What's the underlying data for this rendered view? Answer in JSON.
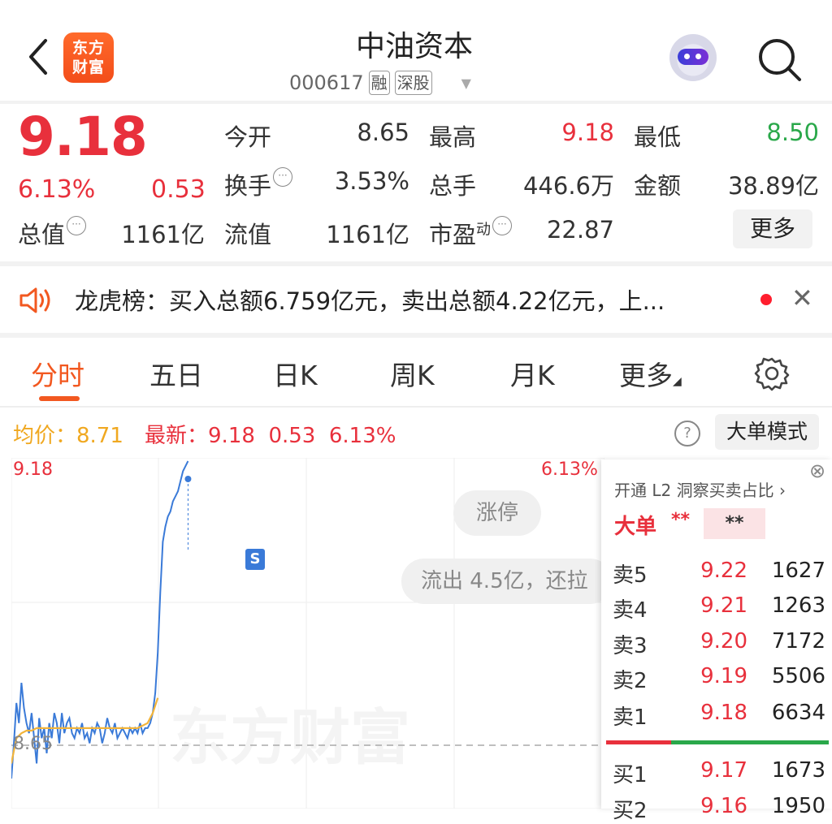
{
  "header": {
    "title": "中油资本",
    "code": "000617",
    "tags": [
      "融",
      "深股"
    ],
    "logo_text_top": "东方",
    "logo_text_bottom": "财富"
  },
  "quote": {
    "price": "9.18",
    "change_pct": "6.13%",
    "change": "0.53",
    "fields": [
      {
        "label": "今开",
        "value": "8.65",
        "tone": "neutral"
      },
      {
        "label": "最高",
        "value": "9.18",
        "tone": "up"
      },
      {
        "label": "最低",
        "value": "8.50",
        "tone": "down"
      },
      {
        "label": "换手",
        "value": "3.53%",
        "tone": "neutral"
      },
      {
        "label": "总手",
        "value": "446.6万",
        "tone": "neutral"
      },
      {
        "label": "金额",
        "value": "38.89亿",
        "tone": "neutral"
      },
      {
        "label": "总值",
        "value": "1161亿",
        "tone": "neutral"
      },
      {
        "label": "流值",
        "value": "1161亿",
        "tone": "neutral"
      },
      {
        "label": "市盈",
        "label_sup": "动",
        "value": "22.87",
        "tone": "neutral"
      }
    ],
    "more_label": "更多"
  },
  "notice": {
    "text": "龙虎榜：买入总额6.759亿元，卖出总额4.22亿元，上..."
  },
  "tabs": [
    "分时",
    "五日",
    "日K",
    "周K",
    "月K",
    "更多"
  ],
  "active_tab": 0,
  "indicators": {
    "avg_label": "均价：8.71",
    "latest_label": "最新：",
    "latest_price": "9.18",
    "latest_change": "0.53",
    "latest_pct": "6.13%",
    "big_order_mode": "大单模式"
  },
  "chart_data": {
    "type": "line",
    "axis_top_label": "9.18",
    "axis_top_pct": "6.13%",
    "axis_mid_label": "8.65",
    "ylim": [
      8.5,
      9.18
    ],
    "watermark": "东方财富",
    "series": [
      {
        "name": "",
        "role": "price",
        "color": "#3a7ad8",
        "x": [
          0,
          2,
          4,
          6,
          8,
          10,
          12,
          14,
          16,
          18,
          20,
          22,
          24,
          26,
          28,
          30,
          32,
          34,
          36,
          38,
          40,
          42,
          44,
          46,
          48,
          50,
          52,
          54,
          56,
          58,
          60,
          62,
          64,
          66,
          68,
          70,
          72,
          74,
          76,
          78,
          80,
          82,
          84,
          86,
          88,
          90,
          92,
          94,
          96,
          98,
          100,
          102,
          104,
          106,
          108,
          110,
          112,
          114,
          116,
          118,
          120,
          122,
          124,
          126,
          128,
          130,
          132,
          134,
          136,
          138,
          140
        ],
        "values": [
          8.55,
          8.62,
          8.7,
          8.66,
          8.74,
          8.69,
          8.66,
          8.64,
          8.68,
          8.63,
          8.58,
          8.67,
          8.63,
          8.65,
          8.6,
          8.66,
          8.63,
          8.68,
          8.66,
          8.62,
          8.68,
          8.64,
          8.66,
          8.67,
          8.64,
          8.63,
          8.65,
          8.64,
          8.66,
          8.63,
          8.64,
          8.62,
          8.65,
          8.64,
          8.66,
          8.65,
          8.62,
          8.64,
          8.67,
          8.65,
          8.64,
          8.66,
          8.63,
          8.64,
          8.65,
          8.64,
          8.63,
          8.65,
          8.64,
          8.65,
          8.64,
          8.66,
          8.64,
          8.65,
          8.65,
          8.66,
          8.68,
          8.72,
          8.8,
          8.92,
          9.02,
          9.05,
          9.07,
          9.08,
          9.1,
          9.11,
          9.12,
          9.14,
          9.16,
          9.17,
          9.18
        ]
      },
      {
        "name": "",
        "role": "average",
        "color": "#f2b43a",
        "x": [
          0,
          4,
          8,
          12,
          16,
          20,
          40,
          60,
          80,
          100,
          108,
          112,
          116
        ],
        "values": [
          8.58,
          8.63,
          8.64,
          8.645,
          8.645,
          8.65,
          8.65,
          8.65,
          8.65,
          8.65,
          8.66,
          8.68,
          8.71
        ]
      }
    ],
    "markers": [
      {
        "label": "S"
      }
    ],
    "bubbles": [
      "涨停",
      "流出 4.5亿，还拉"
    ]
  },
  "order_book": {
    "promo": "开通 L2 洞察买卖占比",
    "big_order_label": "大单",
    "stars_a": "**",
    "stars_b": "**",
    "asks": [
      {
        "label": "卖5",
        "price": "9.22",
        "volume": "1627"
      },
      {
        "label": "卖4",
        "price": "9.21",
        "volume": "1263"
      },
      {
        "label": "卖3",
        "price": "9.20",
        "volume": "7172"
      },
      {
        "label": "卖2",
        "price": "9.19",
        "volume": "5506"
      },
      {
        "label": "卖1",
        "price": "9.18",
        "volume": "6634"
      }
    ],
    "bids": [
      {
        "label": "买1",
        "price": "9.17",
        "volume": "1673"
      },
      {
        "label": "买2",
        "price": "9.16",
        "volume": "1950"
      }
    ]
  }
}
